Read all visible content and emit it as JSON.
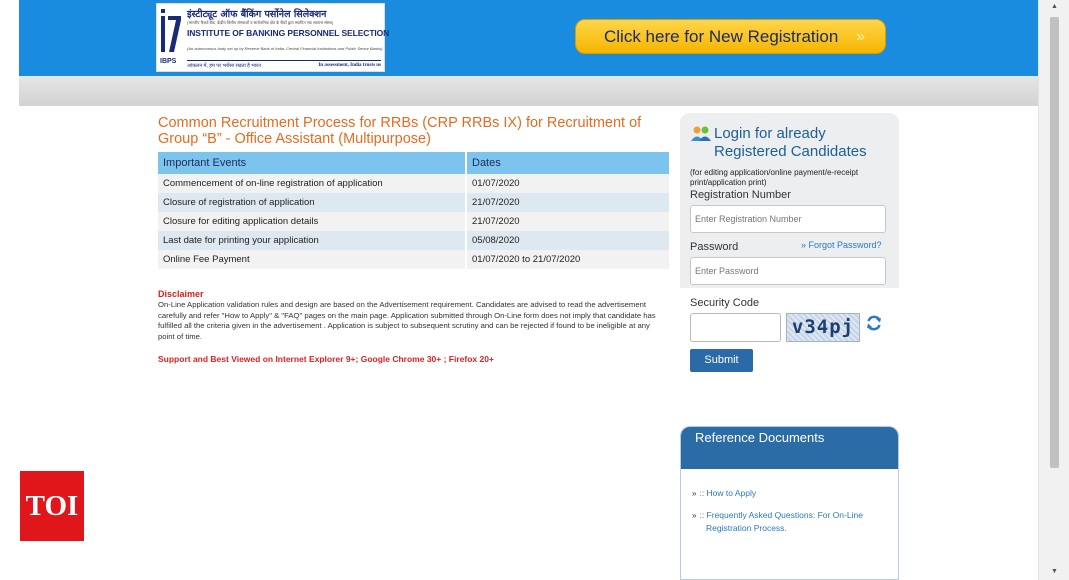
{
  "header": {
    "logo": {
      "hindi_name": "इंस्टीट्यूट ऑफ बैंकिंग पर्सोनेल सिलेक्शन",
      "hindi_subtitle": "(भारतीय रिज़र्व बैंक, केंद्रीय वित्तीय संस्थाओं व सार्वजनिक क्षेत्र के बैंकों द्वारा स्थापित एक स्वायत्त संस्था)",
      "english_name": "INSTITUTE OF BANKING PERSONNEL SELECTION",
      "english_subtitle": "(An autonomous body set up by Reserve Bank of India, Central Financial Institutions and Public Sector Banks)",
      "acronym": "IBPS",
      "hindi_tagline": "आंकलन में, हम पर भरोसा रखता है भारत",
      "english_tagline": "In assessment, India trusts us"
    },
    "registration_button": "Click here for New Registration",
    "registration_button_chevron": "»"
  },
  "main": {
    "title": "Common Recruitment Process for RRBs (CRP RRBs IX) for Recruitment of Group “B” - Office Assistant (Multipurpose)",
    "table": {
      "headers": [
        "Important Events",
        "Dates"
      ],
      "rows": [
        [
          "Commencement of on-line registration of application",
          "01/07/2020"
        ],
        [
          "Closure of registration of application",
          "21/07/2020"
        ],
        [
          "Closure for editing application details",
          "21/07/2020"
        ],
        [
          "Last date for printing your application",
          "05/08/2020"
        ],
        [
          "Online Fee Payment",
          "01/07/2020 to 21/07/2020"
        ]
      ]
    },
    "disclaimer_title": "Disclaimer",
    "disclaimer_text": "On-Line Application validation rules and design are based on the Advertisement requirement. Candidates are advised to read the advertisement carefully and refer \"How to Apply\" & \"FAQ\" pages on the main page. Application submitted through On-Line form does not imply that candidate has fulfilled all the criteria given in the advertisement . Application is subject to subsequent scrutiny and can be rejected if found to be ineligible at any point of time.",
    "browser_note": "Support and Best Viewed on Internet Explorer 9+; Google Chrome 30+ ; Firefox 20+"
  },
  "login": {
    "title": "Login for already Registered Candidates",
    "hint": "(for editing application/online payment/e-receipt print/application print)",
    "registration_label": "Registration Number",
    "registration_placeholder": "Enter Registration Number",
    "password_label": "Password",
    "forgot_password": "Forgot Password?",
    "forgot_arrow": "»",
    "password_placeholder": "Enter Password",
    "security_label": "Security Code",
    "captcha_text": "v34pj",
    "submit": "Submit"
  },
  "reference_docs": {
    "title": "Reference Documents",
    "items": [
      {
        "arrow": "»",
        "label": ":: How to Apply"
      },
      {
        "arrow": "»",
        "label": ":: Frequently Asked Questions: For On-Line Registration Process."
      }
    ]
  },
  "badge": {
    "label": "TOI",
    "color": "#e1161b"
  },
  "colors": {
    "header_blue": "#1a8ce0",
    "accent_orange": "#e56b1f",
    "button_yellow": "#ffd64a",
    "link_blue": "#2a7ac1"
  }
}
